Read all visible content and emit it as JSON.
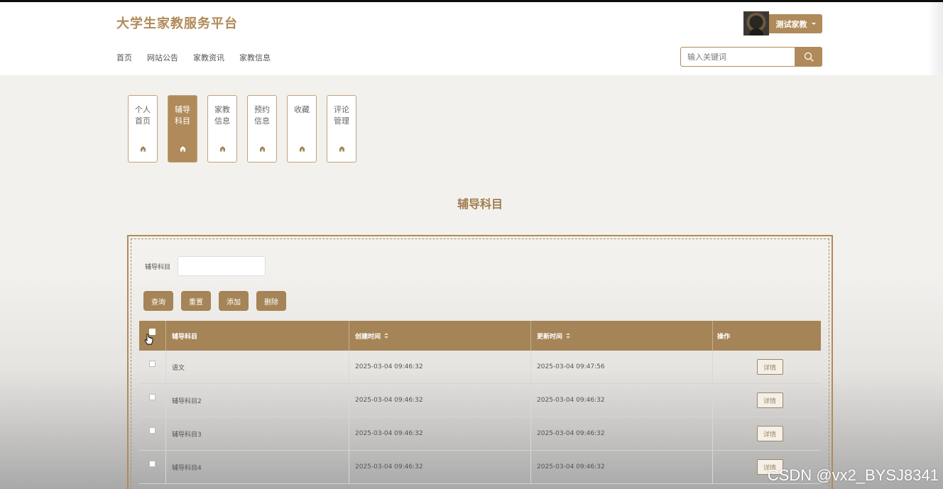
{
  "header": {
    "brand": "大学生家教服务平台",
    "nav": [
      "首页",
      "网站公告",
      "家教资讯",
      "家教信息"
    ],
    "user_label": "测试家教",
    "search_placeholder": "输入关键词"
  },
  "tabs": [
    {
      "label": "个人\n首页",
      "active": false
    },
    {
      "label": "辅导\n科目",
      "active": true
    },
    {
      "label": "家教\n信息",
      "active": false
    },
    {
      "label": "预约\n信息",
      "active": false
    },
    {
      "label": "收藏",
      "active": false
    },
    {
      "label": "评论\n管理",
      "active": false
    }
  ],
  "page_title": "辅导科目",
  "filter": {
    "label": "辅导科目",
    "value": ""
  },
  "buttons": {
    "query": "查询",
    "reset": "重置",
    "add": "添加",
    "delete": "删除"
  },
  "table": {
    "columns": [
      "辅导科目",
      "创建时间",
      "更新时间",
      "操作"
    ],
    "rows": [
      {
        "subject": "语文",
        "created": "2025-03-04 09:46:32",
        "updated": "2025-03-04 09:47:56",
        "action": "详情"
      },
      {
        "subject": "辅导科目2",
        "created": "2025-03-04 09:46:32",
        "updated": "2025-03-04 09:46:32",
        "action": "详情"
      },
      {
        "subject": "辅导科目3",
        "created": "2025-03-04 09:46:32",
        "updated": "2025-03-04 09:46:32",
        "action": "详情"
      },
      {
        "subject": "辅导科目4",
        "created": "2025-03-04 09:46:32",
        "updated": "2025-03-04 09:46:32",
        "action": "详情"
      }
    ]
  },
  "watermark": "CSDN @vx2_BYSJ8341",
  "colors": {
    "accent": "#b08a5a",
    "accent_dark": "#a58457",
    "header_bg": "#ffffff",
    "page_bg": "#f3f1ee"
  },
  "icons": {
    "search": "search-icon",
    "tab": "home-icon",
    "sort": "sort-icon",
    "caret": "caret-down-icon"
  }
}
